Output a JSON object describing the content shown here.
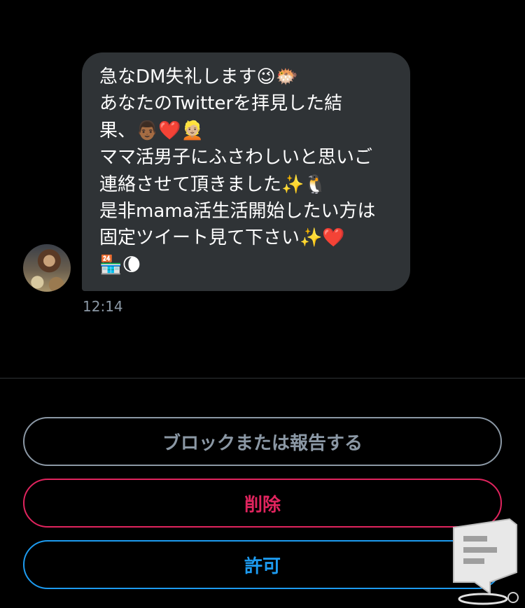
{
  "conversation": {
    "message": {
      "lines": [
        "急なDM失礼します😉🐡",
        "あなたのTwitterを拝見した結",
        "果、👨🏾❤️👱🏼",
        "ママ活男子にふさわしいと思いご",
        "連絡させて頂きました✨🐧",
        "是非mama活生活開始したい方は",
        "固定ツイート見て下さい✨❤️",
        "🏪🌘"
      ],
      "timestamp": "12:14"
    },
    "sender_avatar": "user-photo"
  },
  "actions": {
    "block_report_label": "ブロックまたは報告する",
    "delete_label": "削除",
    "accept_label": "許可"
  },
  "colors": {
    "background": "#000000",
    "bubble": "#2f3336",
    "muted": "#8b98a5",
    "danger": "#e0245e",
    "accent": "#1d9bf0"
  },
  "watermark_icon": "document-stand-icon"
}
